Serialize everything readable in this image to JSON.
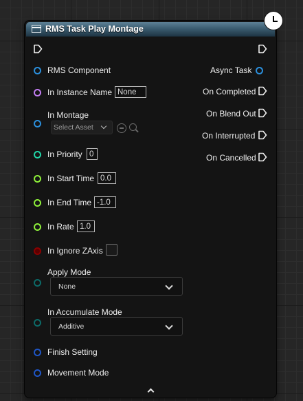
{
  "node": {
    "title": "RMS Task Play Montage",
    "header_color": "#3b5c70",
    "body_color": "#141414"
  },
  "inputs": {
    "rms_component": "RMS Component",
    "in_instance_name": "In Instance Name",
    "in_instance_name_value": "None",
    "in_montage": "In Montage",
    "in_montage_asset": "Select Asset",
    "in_priority": "In Priority",
    "in_priority_value": "0",
    "in_start_time": "In Start Time",
    "in_start_time_value": "0.0",
    "in_end_time": "In End Time",
    "in_end_time_value": "-1.0",
    "in_rate": "In Rate",
    "in_rate_value": "1.0",
    "in_ignore_zaxis": "In Ignore ZAxis",
    "in_ignore_zaxis_checked": false,
    "apply_mode": "Apply Mode",
    "apply_mode_value": "None",
    "in_accumulate_mode": "In Accumulate Mode",
    "in_accumulate_mode_value": "Additive",
    "finish_setting": "Finish Setting",
    "movement_mode": "Movement Mode"
  },
  "outputs": {
    "async_task": "Async Task",
    "on_completed": "On Completed",
    "on_blend_out": "On Blend Out",
    "on_interrupted": "On Interrupted",
    "on_cancelled": "On Cancelled"
  },
  "pin_colors": {
    "object": "#2b8fdc",
    "name": "#c27df2",
    "integer": "#21d6a8",
    "float": "#8ef03a",
    "bool": "#8a0000",
    "enum": "#0c6a68",
    "struct": "#1f56c7"
  },
  "icons": {
    "header": "function-icon",
    "latent": "clock-icon",
    "expand": "chevron-up-icon"
  }
}
